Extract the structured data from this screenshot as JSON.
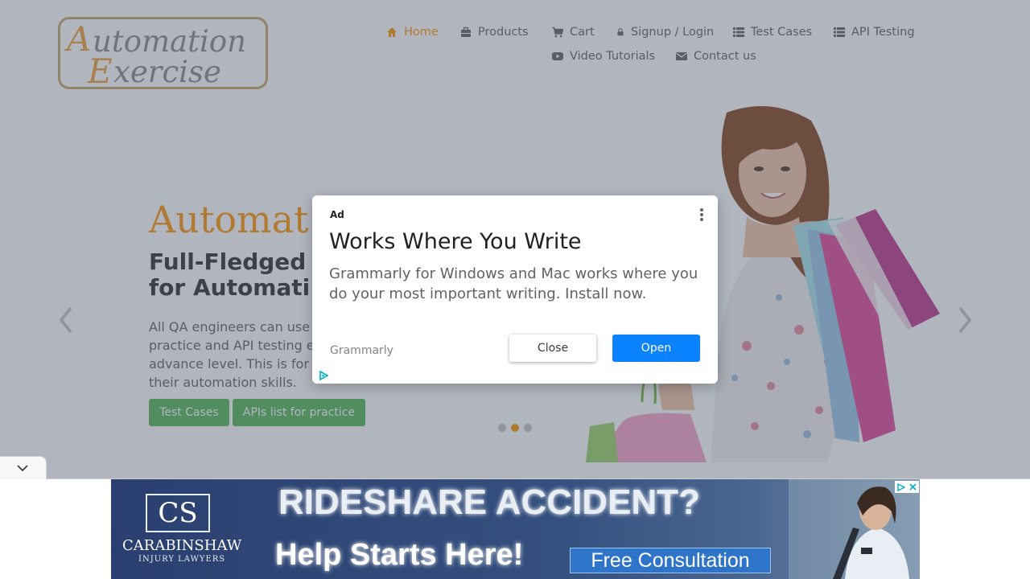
{
  "logo": {
    "line1_cap": "A",
    "line1_rest": "utomation",
    "line2_cap": "E",
    "line2_rest": "xercise"
  },
  "nav": {
    "items": [
      {
        "label": "Home",
        "icon": "home-icon"
      },
      {
        "label": "Products",
        "icon": "briefcase-icon"
      },
      {
        "label": "Cart",
        "icon": "cart-icon"
      },
      {
        "label": "Signup / Login",
        "icon": "lock-icon"
      },
      {
        "label": "Test Cases",
        "icon": "list-icon"
      },
      {
        "label": "API Testing",
        "icon": "list-icon"
      },
      {
        "label": "Video Tutorials",
        "icon": "youtube-icon"
      },
      {
        "label": "Contact us",
        "icon": "envelope-icon"
      }
    ],
    "active": "Home"
  },
  "hero": {
    "title": "Automat",
    "subtitle_line1": "Full-Fledged",
    "subtitle_line2": "for Automati",
    "desc_lines": [
      "All QA engineers can use",
      "practice and API testing e",
      "advance level. This is for",
      "their automation skills."
    ],
    "buttons": [
      "Test Cases",
      "APIs list for practice"
    ],
    "carousel_active_index": 1,
    "carousel_count": 3
  },
  "modal_ad": {
    "ad_label": "Ad",
    "title": "Works Where You Write",
    "body": "Grammarly for Windows and Mac works where you do your most important writing. Install now.",
    "brand": "Grammarly",
    "close_label": "Close",
    "open_label": "Open"
  },
  "banner_ad": {
    "logo_mark": "CS",
    "logo_name": "CARABINSHAW",
    "logo_sub": "INJURY LAWYERS",
    "headline": "RIDESHARE ACCIDENT?",
    "subheadline": "Help Starts Here!",
    "cta": "Free Consultation"
  },
  "colors": {
    "accent": "#fe980f",
    "green_button": "#5cb85c",
    "ad_open_button": "#0b82ff",
    "banner_blue": "#34507f"
  }
}
